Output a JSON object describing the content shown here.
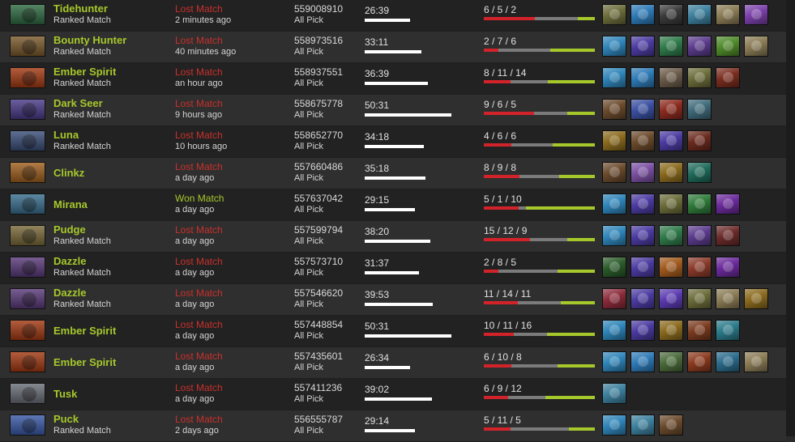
{
  "matches": [
    {
      "hero": "Tidehunter",
      "mode": "Ranked Match",
      "result": "Lost Match",
      "result_class": "lost",
      "time": "2 minutes ago",
      "match_id": "559008910",
      "pick": "All Pick",
      "duration": "26:39",
      "dur_minutes": 26.65,
      "kda": "6 / 5 / 2",
      "k": 6,
      "d": 5,
      "a": 2,
      "portrait_color": "#2f6b43",
      "items": [
        {
          "name": "drum-icon",
          "color": "#6b6c3a"
        },
        {
          "name": "orb-icon",
          "color": "#2d79b5"
        },
        {
          "name": "claw-icon",
          "color": "#3a3a3a"
        },
        {
          "name": "blade-icon",
          "color": "#3c7f9c"
        },
        {
          "name": "scroll-icon",
          "color": "#8a7b55"
        },
        {
          "name": "gem-icon",
          "color": "#7a3fa8"
        }
      ]
    },
    {
      "hero": "Bounty Hunter",
      "mode": "Ranked Match",
      "result": "Lost Match",
      "result_class": "lost",
      "time": "40 minutes ago",
      "match_id": "558973516",
      "pick": "All Pick",
      "duration": "33:11",
      "dur_minutes": 33.18,
      "kda": "2 / 7 / 6",
      "k": 2,
      "d": 7,
      "a": 6,
      "portrait_color": "#7b5a2c",
      "items": [
        {
          "name": "gem-icon",
          "color": "#2e84b8"
        },
        {
          "name": "boots-icon",
          "color": "#4b3aa0"
        },
        {
          "name": "staff-icon",
          "color": "#2f7a4a"
        },
        {
          "name": "orb-icon",
          "color": "#5b3b8c"
        },
        {
          "name": "fruit-icon",
          "color": "#4f8a2a"
        },
        {
          "name": "scroll-icon",
          "color": "#8a7b55"
        }
      ]
    },
    {
      "hero": "Ember Spirit",
      "mode": "Ranked Match",
      "result": "Lost Match",
      "result_class": "lost",
      "time": "an hour ago",
      "match_id": "558937551",
      "pick": "All Pick",
      "duration": "36:39",
      "dur_minutes": 36.65,
      "kda": "8 / 11 / 14",
      "k": 8,
      "d": 11,
      "a": 14,
      "portrait_color": "#a33a12",
      "items": [
        {
          "name": "gem-icon",
          "color": "#2e84b8"
        },
        {
          "name": "orb-icon",
          "color": "#2d79b5"
        },
        {
          "name": "dagger-icon",
          "color": "#6a5a48"
        },
        {
          "name": "drum-icon",
          "color": "#6b6c3a"
        },
        {
          "name": "sword-icon",
          "color": "#7a2c1e"
        }
      ]
    },
    {
      "hero": "Dark Seer",
      "mode": "Ranked Match",
      "result": "Lost Match",
      "result_class": "lost",
      "time": "9 hours ago",
      "match_id": "558675778",
      "pick": "All Pick",
      "duration": "50:31",
      "dur_minutes": 50.52,
      "kda": "9 / 6 / 5",
      "k": 9,
      "d": 6,
      "a": 5,
      "portrait_color": "#4b3b8a",
      "items": [
        {
          "name": "boots-icon",
          "color": "#6a4a2c"
        },
        {
          "name": "scepter-icon",
          "color": "#3a4fa0"
        },
        {
          "name": "mask-icon",
          "color": "#8a2a1e"
        },
        {
          "name": "helm-icon",
          "color": "#3f6a7a"
        }
      ]
    },
    {
      "hero": "Luna",
      "mode": "Ranked Match",
      "result": "Lost Match",
      "result_class": "lost",
      "time": "10 hours ago",
      "match_id": "558652770",
      "pick": "All Pick",
      "duration": "34:18",
      "dur_minutes": 34.3,
      "kda": "4 / 6 / 6",
      "k": 4,
      "d": 6,
      "a": 6,
      "portrait_color": "#3b4f7a",
      "items": [
        {
          "name": "wand-icon",
          "color": "#8a6a1e"
        },
        {
          "name": "boots-icon",
          "color": "#6a4a2c"
        },
        {
          "name": "boots-icon",
          "color": "#4b3aa0"
        },
        {
          "name": "cloak-icon",
          "color": "#6a2a1e"
        }
      ]
    },
    {
      "hero": "Clinkz",
      "mode": "",
      "result": "Lost Match",
      "result_class": "lost",
      "time": "a day ago",
      "match_id": "557660486",
      "pick": "All Pick",
      "duration": "35:18",
      "dur_minutes": 35.3,
      "kda": "8 / 9 / 8",
      "k": 8,
      "d": 9,
      "a": 8,
      "portrait_color": "#a0601e",
      "items": [
        {
          "name": "boots-icon",
          "color": "#6a4a2c"
        },
        {
          "name": "scepter-icon",
          "color": "#7a4fa0"
        },
        {
          "name": "wand-icon",
          "color": "#8a6a1e"
        },
        {
          "name": "bow-icon",
          "color": "#1f6a5a"
        }
      ]
    },
    {
      "hero": "Mirana",
      "mode": "",
      "result": "Won Match",
      "result_class": "won",
      "time": "a day ago",
      "match_id": "557637042",
      "pick": "All Pick",
      "duration": "29:15",
      "dur_minutes": 29.25,
      "kda": "5 / 1 / 10",
      "k": 5,
      "d": 1,
      "a": 10,
      "portrait_color": "#3a6f8f",
      "items": [
        {
          "name": "gem-icon",
          "color": "#2e84b8"
        },
        {
          "name": "boots-icon",
          "color": "#4b3aa0"
        },
        {
          "name": "drum-icon",
          "color": "#6b6c3a"
        },
        {
          "name": "dagger-icon",
          "color": "#2f7a3a"
        },
        {
          "name": "whip-icon",
          "color": "#6a2a9a"
        }
      ]
    },
    {
      "hero": "Pudge",
      "mode": "Ranked Match",
      "result": "Lost Match",
      "result_class": "lost",
      "time": "a day ago",
      "match_id": "557599794",
      "pick": "All Pick",
      "duration": "38:20",
      "dur_minutes": 38.33,
      "kda": "15 / 12 / 9",
      "k": 15,
      "d": 12,
      "a": 9,
      "portrait_color": "#7a6a3a",
      "items": [
        {
          "name": "gem-icon",
          "color": "#2e84b8"
        },
        {
          "name": "boots-icon",
          "color": "#4b3aa0"
        },
        {
          "name": "staff-icon",
          "color": "#2f7a4a"
        },
        {
          "name": "orb-icon",
          "color": "#5b3b8c"
        },
        {
          "name": "book-icon",
          "color": "#6a2a2a"
        }
      ]
    },
    {
      "hero": "Dazzle",
      "mode": "Ranked Match",
      "result": "Lost Match",
      "result_class": "lost",
      "time": "a day ago",
      "match_id": "557573710",
      "pick": "All Pick",
      "duration": "31:37",
      "dur_minutes": 31.62,
      "kda": "2 / 8 / 5",
      "k": 2,
      "d": 8,
      "a": 5,
      "portrait_color": "#5a3a7a",
      "items": [
        {
          "name": "staff-icon",
          "color": "#2a5a2a"
        },
        {
          "name": "boots-icon",
          "color": "#4b3aa0"
        },
        {
          "name": "flame-icon",
          "color": "#a05a1e"
        },
        {
          "name": "axe-icon",
          "color": "#8a3a2a"
        },
        {
          "name": "whip-icon",
          "color": "#6a2a9a"
        }
      ]
    },
    {
      "hero": "Dazzle",
      "mode": "Ranked Match",
      "result": "Lost Match",
      "result_class": "lost",
      "time": "a day ago",
      "match_id": "557546620",
      "pick": "All Pick",
      "duration": "39:53",
      "dur_minutes": 39.88,
      "kda": "11 / 14 / 11",
      "k": 11,
      "d": 14,
      "a": 11,
      "portrait_color": "#5a3a7a",
      "items": [
        {
          "name": "feather-icon",
          "color": "#8a2a3a"
        },
        {
          "name": "boots-icon",
          "color": "#4b3aa0"
        },
        {
          "name": "boots-icon",
          "color": "#5a3ab0"
        },
        {
          "name": "drum-icon",
          "color": "#6b6c3a"
        },
        {
          "name": "scroll-icon",
          "color": "#8a7b55"
        },
        {
          "name": "gem-icon",
          "color": "#8a6a1e"
        }
      ]
    },
    {
      "hero": "Ember Spirit",
      "mode": "",
      "result": "Lost Match",
      "result_class": "lost",
      "time": "a day ago",
      "match_id": "557448854",
      "pick": "All Pick",
      "duration": "50:31",
      "dur_minutes": 50.52,
      "kda": "10 / 11 / 16",
      "k": 10,
      "d": 11,
      "a": 16,
      "portrait_color": "#a33a12",
      "items": [
        {
          "name": "gem-icon",
          "color": "#2e84b8"
        },
        {
          "name": "boots-icon",
          "color": "#4b3aa0"
        },
        {
          "name": "horn-icon",
          "color": "#8a6a1e"
        },
        {
          "name": "hook-icon",
          "color": "#7a3a1e"
        },
        {
          "name": "dragon-icon",
          "color": "#2a7a8a"
        }
      ]
    },
    {
      "hero": "Ember Spirit",
      "mode": "",
      "result": "Lost Match",
      "result_class": "lost",
      "time": "a day ago",
      "match_id": "557435601",
      "pick": "All Pick",
      "duration": "26:34",
      "dur_minutes": 26.57,
      "kda": "6 / 10 / 8",
      "k": 6,
      "d": 10,
      "a": 8,
      "portrait_color": "#a33a12",
      "items": [
        {
          "name": "gem-icon",
          "color": "#2e84b8"
        },
        {
          "name": "orb-icon",
          "color": "#2d79b5"
        },
        {
          "name": "staff-icon",
          "color": "#4a6a3a"
        },
        {
          "name": "flame-icon",
          "color": "#8a3a1e"
        },
        {
          "name": "shield-icon",
          "color": "#2a6a8a"
        },
        {
          "name": "scroll-icon",
          "color": "#8a7b55"
        }
      ]
    },
    {
      "hero": "Tusk",
      "mode": "",
      "result": "Lost Match",
      "result_class": "lost",
      "time": "a day ago",
      "match_id": "557411236",
      "pick": "All Pick",
      "duration": "39:02",
      "dur_minutes": 39.03,
      "kda": "6 / 9 / 12",
      "k": 6,
      "d": 9,
      "a": 12,
      "portrait_color": "#6a6f78",
      "items": [
        {
          "name": "blade-icon",
          "color": "#3c7f9c"
        }
      ]
    },
    {
      "hero": "Puck",
      "mode": "Ranked Match",
      "result": "Lost Match",
      "result_class": "lost",
      "time": "2 days ago",
      "match_id": "556555787",
      "pick": "All Pick",
      "duration": "29:14",
      "dur_minutes": 29.23,
      "kda": "5 / 11 / 5",
      "k": 5,
      "d": 11,
      "a": 5,
      "portrait_color": "#3a5aa8",
      "items": [
        {
          "name": "gem-icon",
          "color": "#2e84b8"
        },
        {
          "name": "blade-icon",
          "color": "#3c7f9c"
        },
        {
          "name": "boots-icon",
          "color": "#6a4a2c"
        }
      ]
    }
  ]
}
